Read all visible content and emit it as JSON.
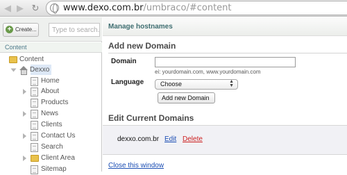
{
  "browser": {
    "url_domain": "www.dexo.com.br",
    "url_path": "/umbraco/#content"
  },
  "sidebar": {
    "create_label": "Create...",
    "search_placeholder": "Type to search...",
    "section_label": "Content",
    "tree": [
      {
        "label": "Content",
        "icon": "folder-icon"
      },
      {
        "label": "Dexxo",
        "icon": "home-icon",
        "selected": true
      },
      {
        "label": "Home",
        "icon": "document-icon"
      },
      {
        "label": "About",
        "icon": "document-icon"
      },
      {
        "label": "Products",
        "icon": "document-icon"
      },
      {
        "label": "News",
        "icon": "document-icon"
      },
      {
        "label": "Clients",
        "icon": "document-icon"
      },
      {
        "label": "Contact Us",
        "icon": "document-icon"
      },
      {
        "label": "Search",
        "icon": "document-icon"
      },
      {
        "label": "Client Area",
        "icon": "folder-icon"
      },
      {
        "label": "Sitemap",
        "icon": "document-icon"
      }
    ]
  },
  "panel": {
    "title": "Manage hostnames",
    "add_section_title": "Add new Domain",
    "domain_label": "Domain",
    "domain_value": "",
    "domain_hint": "ei: yourdomain.com, www.yourdomain.com",
    "language_label": "Language",
    "language_selected": "Choose",
    "add_button_label": "Add new Domain",
    "edit_section_title": "Edit Current Domains",
    "domains": [
      {
        "name": "dexxo.com.br",
        "edit_label": "Edit",
        "delete_label": "Delete"
      }
    ],
    "close_label": "Close this window"
  },
  "colors": {
    "panel_title": "#3f6e71",
    "link": "#1a4db3",
    "delete_link": "#cc1f1f",
    "selected_node": "#dde8f6"
  }
}
